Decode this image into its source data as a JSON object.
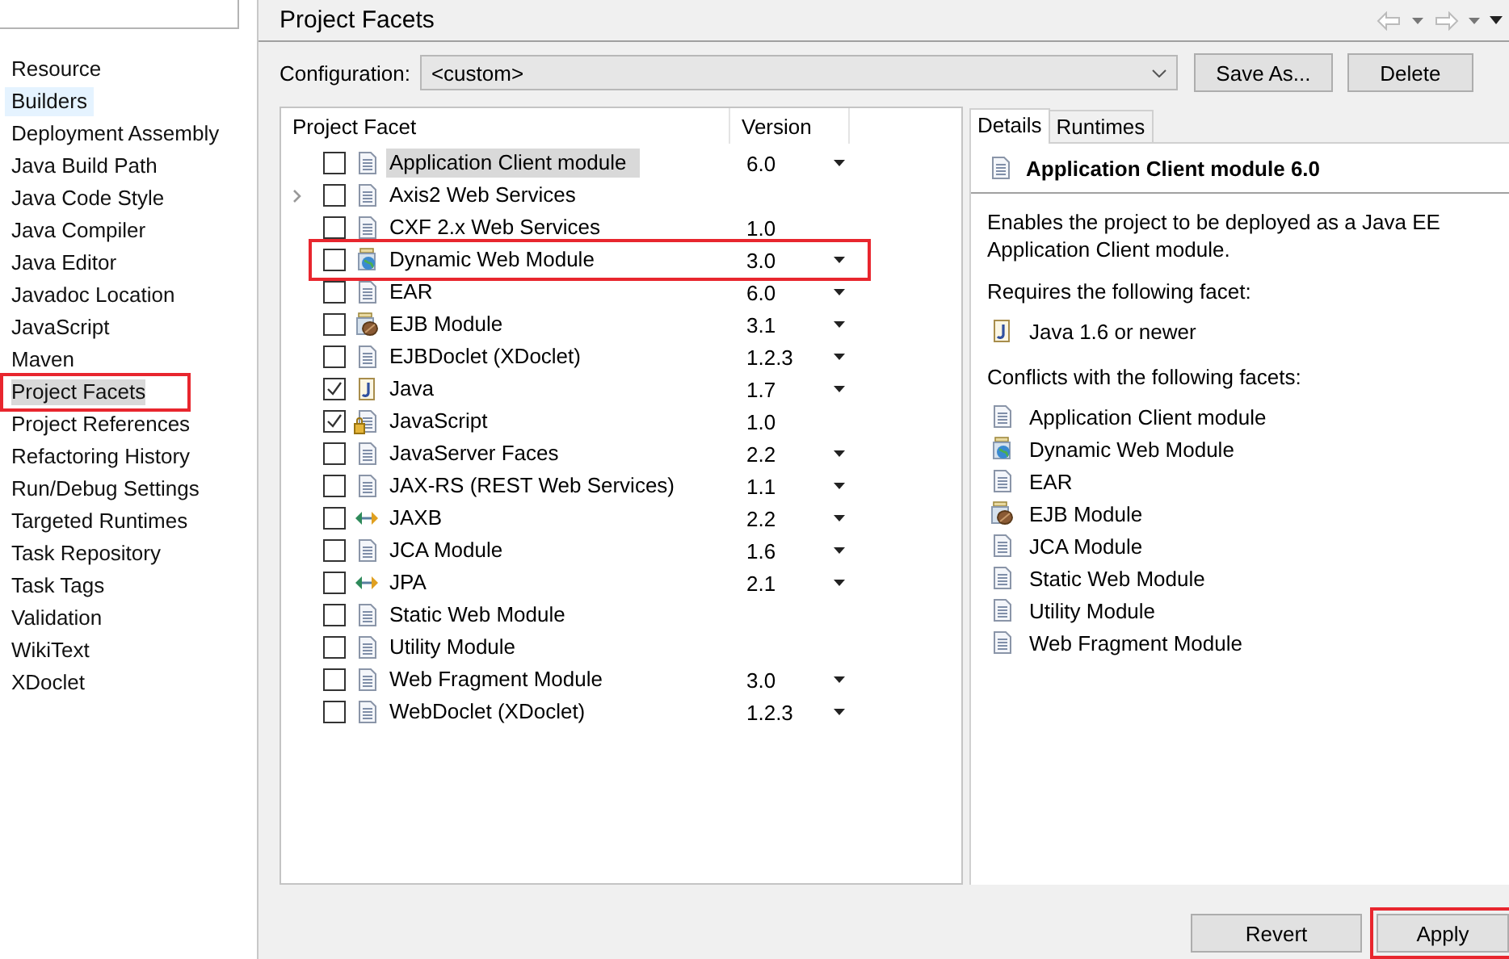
{
  "sidebar": {
    "items": [
      {
        "label": "Resource",
        "selected": false,
        "hovered": false,
        "annotated": false
      },
      {
        "label": "Builders",
        "selected": false,
        "hovered": true,
        "annotated": false
      },
      {
        "label": "Deployment Assembly",
        "selected": false,
        "hovered": false,
        "annotated": false
      },
      {
        "label": "Java Build Path",
        "selected": false,
        "hovered": false,
        "annotated": false
      },
      {
        "label": "Java Code Style",
        "selected": false,
        "hovered": false,
        "annotated": false
      },
      {
        "label": "Java Compiler",
        "selected": false,
        "hovered": false,
        "annotated": false
      },
      {
        "label": "Java Editor",
        "selected": false,
        "hovered": false,
        "annotated": false
      },
      {
        "label": "Javadoc Location",
        "selected": false,
        "hovered": false,
        "annotated": false
      },
      {
        "label": "JavaScript",
        "selected": false,
        "hovered": false,
        "annotated": false
      },
      {
        "label": "Maven",
        "selected": false,
        "hovered": false,
        "annotated": false
      },
      {
        "label": "Project Facets",
        "selected": true,
        "hovered": false,
        "annotated": true
      },
      {
        "label": "Project References",
        "selected": false,
        "hovered": false,
        "annotated": false
      },
      {
        "label": "Refactoring History",
        "selected": false,
        "hovered": false,
        "annotated": false
      },
      {
        "label": "Run/Debug Settings",
        "selected": false,
        "hovered": false,
        "annotated": false
      },
      {
        "label": "Targeted Runtimes",
        "selected": false,
        "hovered": false,
        "annotated": false
      },
      {
        "label": "Task Repository",
        "selected": false,
        "hovered": false,
        "annotated": false
      },
      {
        "label": "Task Tags",
        "selected": false,
        "hovered": false,
        "annotated": false
      },
      {
        "label": "Validation",
        "selected": false,
        "hovered": false,
        "annotated": false
      },
      {
        "label": "WikiText",
        "selected": false,
        "hovered": false,
        "annotated": false
      },
      {
        "label": "XDoclet",
        "selected": false,
        "hovered": false,
        "annotated": false
      }
    ]
  },
  "page": {
    "title": "Project Facets",
    "configuration": {
      "label": "Configuration:",
      "value": "<custom>"
    },
    "buttons": [
      "Save As...",
      "Delete"
    ]
  },
  "facets": {
    "columns": [
      "Project Facet",
      "Version"
    ],
    "rows": [
      {
        "name": "Application Client module",
        "kind": "page",
        "checked": false,
        "selected": true,
        "expandable": false,
        "version": "6.0",
        "dropdown": true,
        "annotated": false
      },
      {
        "name": "Axis2 Web Services",
        "kind": "page",
        "checked": false,
        "selected": false,
        "expandable": true,
        "dropdown": false,
        "annotated": false
      },
      {
        "name": "CXF 2.x Web Services",
        "kind": "page",
        "checked": false,
        "selected": false,
        "expandable": false,
        "version": "1.0",
        "dropdown": false,
        "annotated": false
      },
      {
        "name": "Dynamic Web Module",
        "kind": "web",
        "checked": false,
        "selected": false,
        "expandable": false,
        "version": "3.0",
        "dropdown": true,
        "annotated": true
      },
      {
        "name": "EAR",
        "kind": "page",
        "checked": false,
        "selected": false,
        "expandable": false,
        "version": "6.0",
        "dropdown": true,
        "annotated": false
      },
      {
        "name": "EJB Module",
        "kind": "ejb",
        "checked": false,
        "selected": false,
        "expandable": false,
        "version": "3.1",
        "dropdown": true,
        "annotated": false
      },
      {
        "name": "EJBDoclet (XDoclet)",
        "kind": "page",
        "checked": false,
        "selected": false,
        "expandable": false,
        "version": "1.2.3",
        "dropdown": true,
        "annotated": false
      },
      {
        "name": "Java",
        "kind": "java",
        "checked": true,
        "selected": false,
        "expandable": false,
        "version": "1.7",
        "dropdown": true,
        "annotated": false
      },
      {
        "name": "JavaScript",
        "kind": "locked",
        "checked": true,
        "selected": false,
        "expandable": false,
        "version": "1.0",
        "dropdown": false,
        "annotated": false
      },
      {
        "name": "JavaServer Faces",
        "kind": "page",
        "checked": false,
        "selected": false,
        "expandable": false,
        "version": "2.2",
        "dropdown": true,
        "annotated": false
      },
      {
        "name": "JAX-RS (REST Web Services)",
        "kind": "page",
        "checked": false,
        "selected": false,
        "expandable": false,
        "version": "1.1",
        "dropdown": true,
        "annotated": false
      },
      {
        "name": "JAXB",
        "kind": "arrows",
        "checked": false,
        "selected": false,
        "expandable": false,
        "version": "2.2",
        "dropdown": true,
        "annotated": false
      },
      {
        "name": "JCA Module",
        "kind": "page",
        "checked": false,
        "selected": false,
        "expandable": false,
        "version": "1.6",
        "dropdown": true,
        "annotated": false
      },
      {
        "name": "JPA",
        "kind": "arrows",
        "checked": false,
        "selected": false,
        "expandable": false,
        "version": "2.1",
        "dropdown": true,
        "annotated": false
      },
      {
        "name": "Static Web Module",
        "kind": "page",
        "checked": false,
        "selected": false,
        "expandable": false,
        "dropdown": false,
        "annotated": false
      },
      {
        "name": "Utility Module",
        "kind": "page",
        "checked": false,
        "selected": false,
        "expandable": false,
        "dropdown": false,
        "annotated": false
      },
      {
        "name": "Web Fragment Module",
        "kind": "page",
        "checked": false,
        "selected": false,
        "expandable": false,
        "version": "3.0",
        "dropdown": true,
        "annotated": false
      },
      {
        "name": "WebDoclet (XDoclet)",
        "kind": "page",
        "checked": false,
        "selected": false,
        "expandable": false,
        "version": "1.2.3",
        "dropdown": true,
        "annotated": false
      }
    ]
  },
  "details": {
    "tabs": [
      {
        "label": "Details",
        "selected": true
      },
      {
        "label": "Runtimes",
        "selected": false
      }
    ],
    "title": "Application Client module 6.0",
    "description": "Enables the project to be deployed as a Java EE Application Client module.",
    "requires_label": "Requires the following facet:",
    "requires": [
      {
        "label": "Java 1.6 or newer",
        "kind": "java"
      }
    ],
    "conflicts_label": "Conflicts with the following facets:",
    "conflicts": [
      {
        "label": "Application Client module",
        "kind": "page"
      },
      {
        "label": "Dynamic Web Module",
        "kind": "web"
      },
      {
        "label": "EAR",
        "kind": "page"
      },
      {
        "label": "EJB Module",
        "kind": "ejb"
      },
      {
        "label": "JCA Module",
        "kind": "page"
      },
      {
        "label": "Static Web Module",
        "kind": "page"
      },
      {
        "label": "Utility Module",
        "kind": "page"
      },
      {
        "label": "Web Fragment Module",
        "kind": "page"
      }
    ]
  },
  "footer": {
    "buttons": [
      {
        "label": "Revert",
        "annotated": false
      },
      {
        "label": "Apply",
        "annotated": true
      }
    ]
  }
}
